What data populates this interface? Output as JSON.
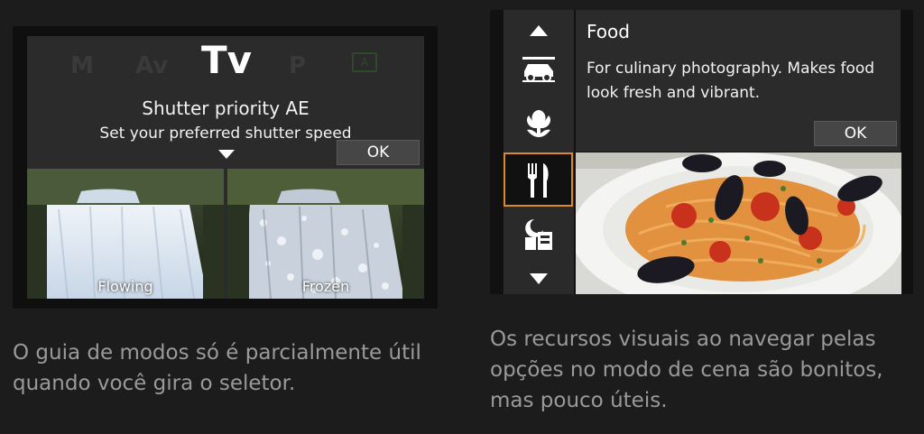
{
  "left_screen": {
    "modes": [
      "M",
      "Av",
      "Tv",
      "P"
    ],
    "active_mode": "Tv",
    "auto_icon": "scene-auto-icon",
    "title": "Shutter priority AE",
    "description": "Set your preferred shutter speed",
    "ok_label": "OK",
    "example_left_label": "Flowing",
    "example_right_label": "Frozen"
  },
  "right_screen": {
    "scene_icons": [
      "arrow-up-icon",
      "car-panning-icon",
      "flower-closeup-icon",
      "food-icon",
      "night-portrait-icon",
      "arrow-down-icon"
    ],
    "selected_scene_icon": "food-icon",
    "title": "Food",
    "description": "For culinary photography. Makes food look fresh and vibrant.",
    "ok_label": "OK",
    "accent_color": "#d98a2b"
  },
  "captions": {
    "left": "O guia de modos só é parcialmente útil quando você gira o seletor.",
    "right": "Os recursos visuais ao navegar pelas opções no modo de cena são bonitos, mas pouco úteis."
  }
}
